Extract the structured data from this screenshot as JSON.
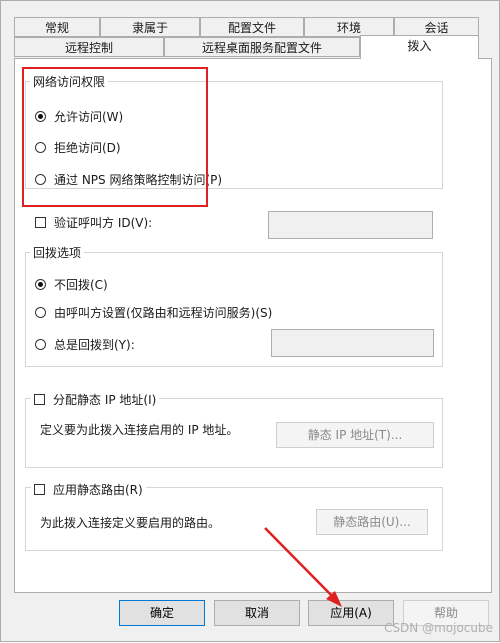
{
  "tabs_row1": [
    "常规",
    "隶属于",
    "配置文件",
    "环境",
    "会话"
  ],
  "tabs_row2": [
    "远程控制",
    "远程桌面服务配置文件",
    "拨入"
  ],
  "network_access": {
    "title": "网络访问权限",
    "options": [
      "允许访问(W)",
      "拒绝访问(D)",
      "通过 NPS 网络策略控制访问(P)"
    ],
    "selected": 0
  },
  "verify_caller_id": {
    "label": "验证呼叫方 ID(V):",
    "value": ""
  },
  "callback": {
    "title": "回拨选项",
    "options": [
      "不回拨(C)",
      "由呼叫方设置(仅路由和远程访问服务)(S)",
      "总是回拨到(Y):"
    ],
    "selected": 0,
    "number_value": ""
  },
  "static_ip": {
    "checkbox_label": "分配静态 IP 地址(I)",
    "description": "定义要为此拨入连接启用的 IP 地址。",
    "button_label": "静态 IP 地址(T)..."
  },
  "static_routes": {
    "checkbox_label": "应用静态路由(R)",
    "description": "为此拨入连接定义要启用的路由。",
    "button_label": "静态路由(U)..."
  },
  "buttons": {
    "ok": "确定",
    "cancel": "取消",
    "apply": "应用(A)",
    "help": "帮助"
  },
  "watermark": "CSDN @mojocube"
}
